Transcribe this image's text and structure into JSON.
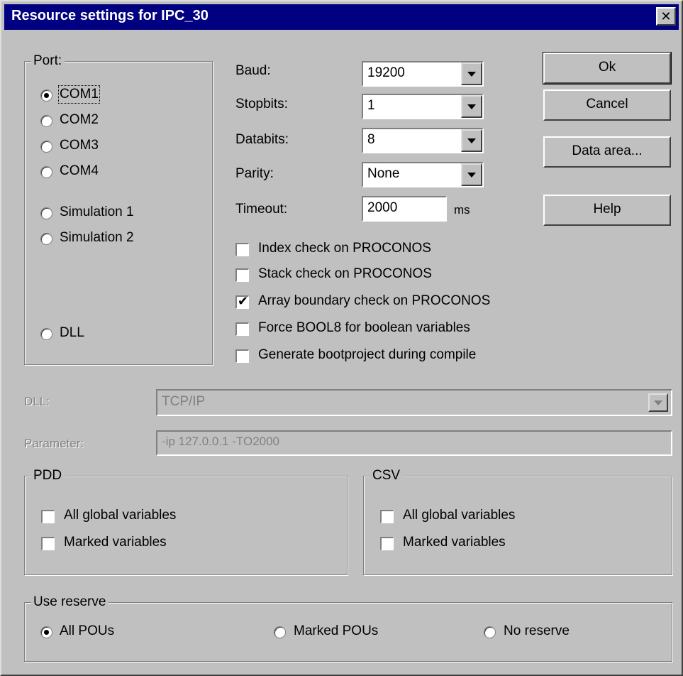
{
  "window": {
    "title": "Resource settings for IPC_30",
    "close_glyph": "✕"
  },
  "port": {
    "legend": "Port:",
    "options": [
      {
        "label": "COM1",
        "selected": true
      },
      {
        "label": "COM2",
        "selected": false
      },
      {
        "label": "COM3",
        "selected": false
      },
      {
        "label": "COM4",
        "selected": false
      },
      {
        "label": "Simulation 1",
        "selected": false
      },
      {
        "label": "Simulation 2",
        "selected": false
      },
      {
        "label": "DLL",
        "selected": false
      }
    ]
  },
  "serial": {
    "baud_label": "Baud:",
    "baud_value": "19200",
    "stopbits_label": "Stopbits:",
    "stopbits_value": "1",
    "databits_label": "Databits:",
    "databits_value": "8",
    "parity_label": "Parity:",
    "parity_value": "None",
    "timeout_label": "Timeout:",
    "timeout_value": "2000",
    "timeout_unit": "ms"
  },
  "checks": [
    {
      "label": "Index check on PROCONOS",
      "checked": false
    },
    {
      "label": "Stack check on PROCONOS",
      "checked": false
    },
    {
      "label": "Array boundary check on PROCONOS",
      "checked": true
    },
    {
      "label": "Force BOOL8 for boolean variables",
      "checked": false
    },
    {
      "label": "Generate bootproject during compile",
      "checked": false
    }
  ],
  "buttons": {
    "ok": "Ok",
    "cancel": "Cancel",
    "data_area": "Data area...",
    "help": "Help"
  },
  "dll": {
    "label": "DLL:",
    "value": "TCP/IP"
  },
  "parameter": {
    "label": "Parameter:",
    "value": "-ip 127.0.0.1 -TO2000"
  },
  "pdd": {
    "legend": "PDD",
    "all_global": "All global variables",
    "marked": "Marked variables"
  },
  "csv": {
    "legend": "CSV",
    "all_global": "All global variables",
    "marked": "Marked variables"
  },
  "reserve": {
    "legend": "Use reserve",
    "options": [
      {
        "label": "All POUs",
        "selected": true
      },
      {
        "label": "Marked POUs",
        "selected": false
      },
      {
        "label": "No reserve",
        "selected": false
      }
    ]
  }
}
